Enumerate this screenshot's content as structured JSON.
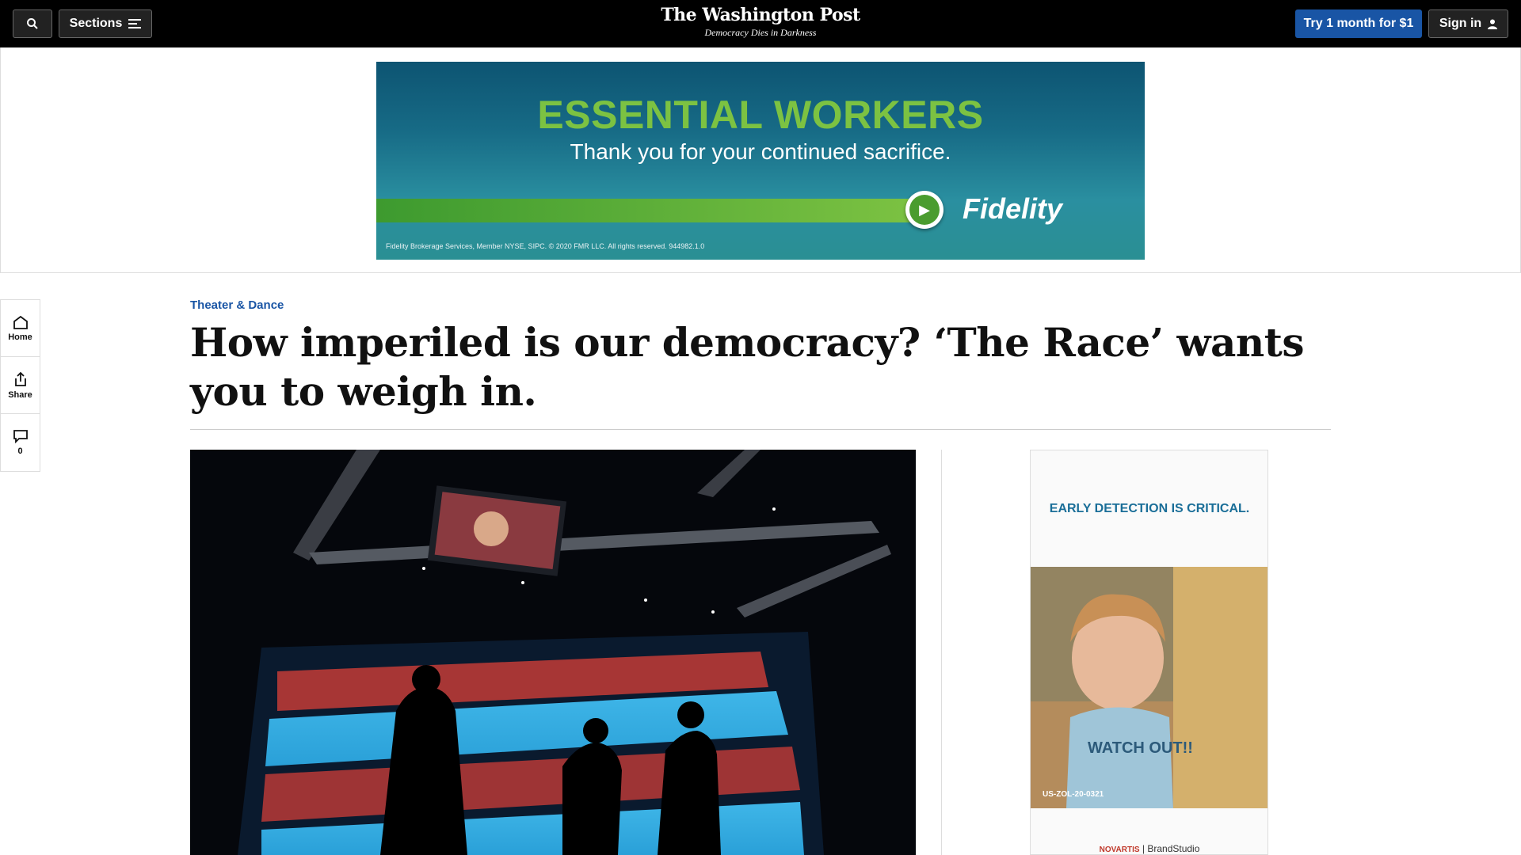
{
  "nav": {
    "sections_label": "Sections",
    "logo": "The Washington Post",
    "tagline": "Democracy Dies in Darkness",
    "try_label": "Try 1 month for $1",
    "signin_label": "Sign in"
  },
  "top_ad": {
    "headline": "ESSENTIAL WORKERS",
    "subline": "Thank you for your continued sacrifice.",
    "brand": "Fidelity",
    "fineprint": "Fidelity Brokerage Services, Member NYSE, SIPC. © 2020 FMR LLC. All rights reserved. 944982.1.0"
  },
  "rail": {
    "home_label": "Home",
    "share_label": "Share",
    "comments_count": "0"
  },
  "article": {
    "kicker": "Theater & Dance",
    "title": "How imperiled is our democracy? ‘The Race’ wants you to weigh in."
  },
  "side_ad": {
    "headline": "EARLY DETECTION IS CRITICAL.",
    "shirt_text": "WATCH OUT!!",
    "code": "US-ZOL-20-0321",
    "footer_left": "NOVARTIS",
    "footer_right": "BrandStudio"
  },
  "colors": {
    "topbar": "#000000",
    "accent_blue": "#1955a5",
    "ad_green": "#7cc242"
  }
}
